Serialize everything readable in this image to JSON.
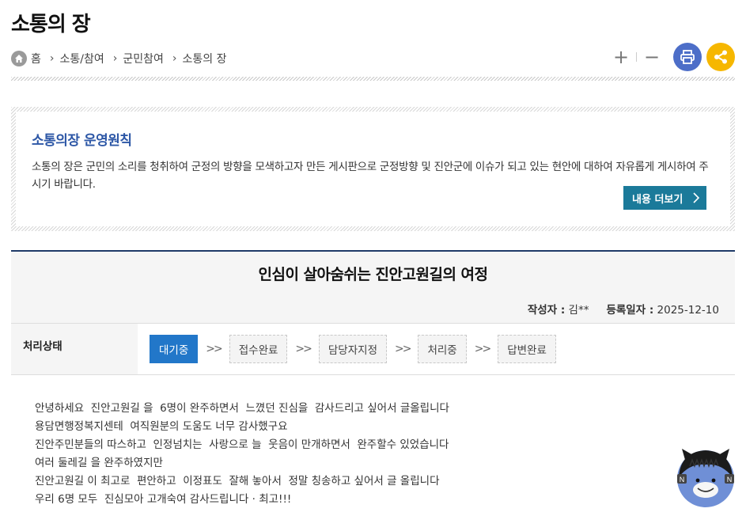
{
  "page": {
    "title": "소통의 장"
  },
  "breadcrumb": {
    "home": "홈",
    "items": [
      "소통/참여",
      "군민참여",
      "소통의 장"
    ]
  },
  "toolbar": {
    "zoom_in": "+",
    "zoom_out": "−",
    "print_icon": "printer-icon",
    "share_icon": "share-icon",
    "print_color": "#4d6ec8",
    "share_color": "#f6b700"
  },
  "notice": {
    "title": "소통의장 운영원칙",
    "text": "소통의 장은 군민의 소리를 청취하여 군정의 방향을 모색하고자 만든 게시판으로 군정방향 및 진안군에 이슈가 되고 있는 현안에 대하여 자유롭게 게시하여 주시기 바랍니다.",
    "more_button": "내용 더보기"
  },
  "post": {
    "title": "인심이 살아숨쉬는 진안고원길의 여정",
    "author_label": "작성자 :",
    "author": "김**",
    "date_label": "등록일자 :",
    "date": "2025-12-10",
    "status_label": "처리상태",
    "steps": [
      "대기중",
      "접수완료",
      "담당자지정",
      "처리중",
      "답변완료"
    ],
    "active_step": "대기중",
    "step_arrow": ">>",
    "body": "안녕하세요  진안고원길 을  6명이 완주하면서  느꼈던 진심을  감사드리고 싶어서 글올립니다\n용담면행정복지센테  여직원분의 도움도 너무 감사했구요\n진안주민분들의 따스하고  인정넘치는  사랑으로 늘  웃음이 만개하면서  완주할수 있었습니다\n여러 둘레길 을 완주하였지만\n진안고원길 이 최고로  편안하고  이정표도  잘해 놓아서  정말 칭송하고 싶어서 글 올립니다\n우리 6명 모두  진심모아 고개숙여 감사드립니다 · 최고!!!"
  },
  "colors": {
    "accent_blue": "#2d57a6",
    "post_border": "#1f3a68",
    "active_step": "#2277c9",
    "more_button": "#1b7a9a"
  }
}
